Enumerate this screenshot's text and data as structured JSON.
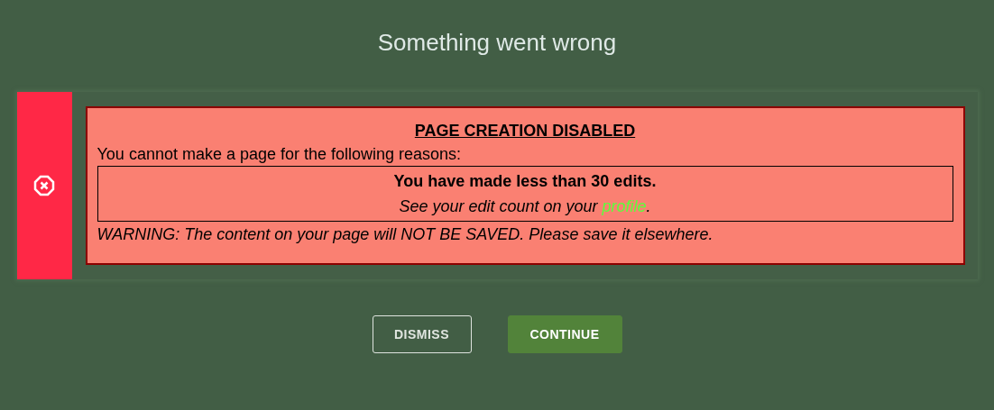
{
  "title": "Something went wrong",
  "alert": {
    "heading": "PAGE CREATION DISABLED",
    "intro": "You cannot make a page for the following reasons:",
    "reasons": [
      {
        "headline": "You have made less than 30 edits.",
        "note_before": "See your edit count on your ",
        "note_link": "profile",
        "note_after": "."
      }
    ],
    "warning": "WARNING: The content on your page will NOT BE SAVED. Please save it elsewhere."
  },
  "buttons": [
    {
      "label": "DISMISS",
      "kind": "outline"
    },
    {
      "label": "CONTINUE",
      "kind": "primary"
    }
  ]
}
